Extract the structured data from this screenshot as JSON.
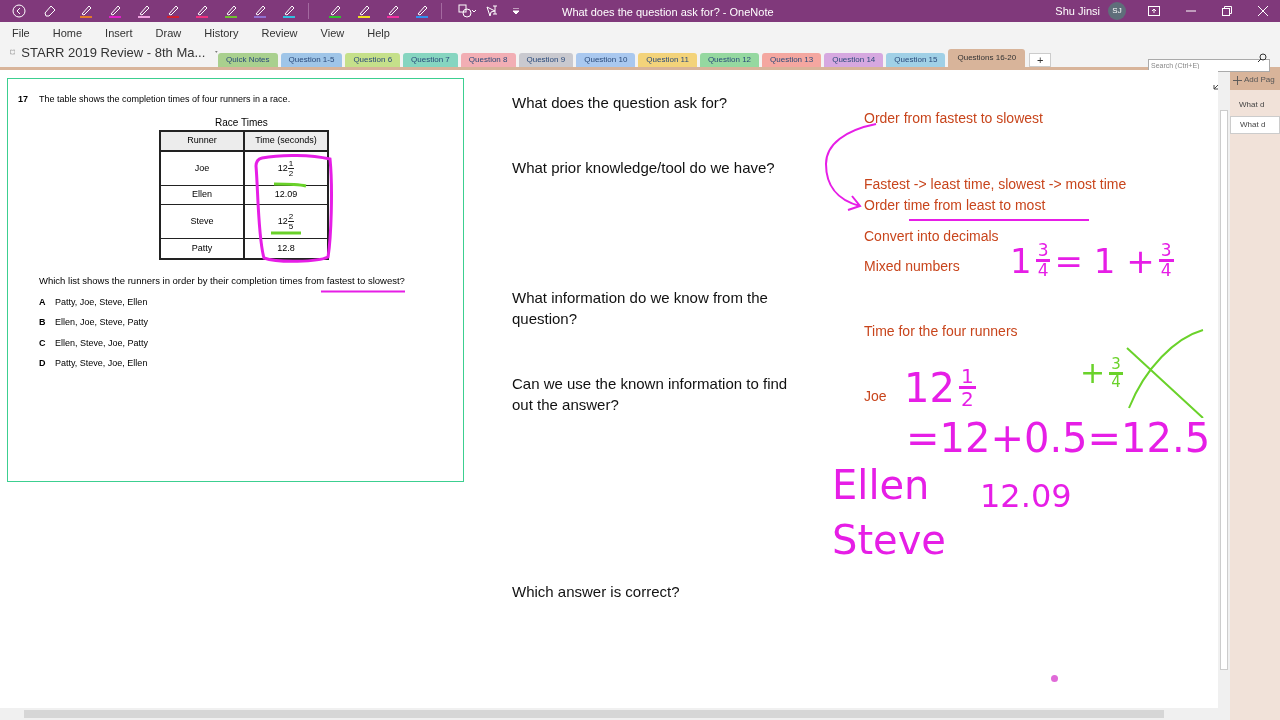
{
  "window": {
    "title": "What does the question ask for?  -  OneNote",
    "user": "Shu Jinsi",
    "initials": "SJ"
  },
  "pens": [
    {
      "color": "#e07a2a"
    },
    {
      "color": "#e020c8"
    },
    {
      "color": "#f0a0e0"
    },
    {
      "color": "#d02030"
    },
    {
      "color": "#f03080"
    },
    {
      "color": "#70c030"
    },
    {
      "color": "#9070d0"
    },
    {
      "color": "#30c0e0"
    }
  ],
  "highlighters": [
    {
      "color": "#30c030"
    },
    {
      "color": "#f0e020"
    },
    {
      "color": "#f030a0"
    },
    {
      "color": "#3090f0"
    }
  ],
  "menu": [
    "File",
    "Home",
    "Insert",
    "Draw",
    "History",
    "Review",
    "View",
    "Help"
  ],
  "notebook": "STARR 2019 Review - 8th Ma...",
  "sections": [
    {
      "label": "Quick Notes",
      "color": "#a9d08e",
      "selected": false
    },
    {
      "label": "Question 1-5",
      "color": "#9fc5e8",
      "selected": false
    },
    {
      "label": "Question 6",
      "color": "#c5e08a",
      "selected": false
    },
    {
      "label": "Question 7",
      "color": "#86d5c0",
      "selected": false
    },
    {
      "label": "Question 8",
      "color": "#f2aeb4",
      "selected": false
    },
    {
      "label": "Question 9",
      "color": "#c9c9cf",
      "selected": false
    },
    {
      "label": "Question 10",
      "color": "#a9c8ef",
      "selected": false
    },
    {
      "label": "Question 11",
      "color": "#f3d37a",
      "selected": false
    },
    {
      "label": "Question 12",
      "color": "#95d8a0",
      "selected": false
    },
    {
      "label": "Question 13",
      "color": "#f4a7a0",
      "selected": false
    },
    {
      "label": "Question 14",
      "color": "#d6a8e0",
      "selected": false
    },
    {
      "label": "Question 15",
      "color": "#a0d0e6",
      "selected": false
    },
    {
      "label": "Questions 16-20",
      "color": "#d8b49a",
      "selected": true
    }
  ],
  "add_section": "+",
  "search": {
    "placeholder": "Search (Ctrl+E)"
  },
  "pages_panel": {
    "add": "Add Pag",
    "pages": [
      {
        "title": "What d",
        "selected": false
      },
      {
        "title": "What d",
        "selected": true
      }
    ]
  },
  "question": {
    "number": "17",
    "stem": "The table shows the completion times of four runners in a race.",
    "table_title": "Race Times",
    "columns": [
      "Runner",
      "Time (seconds)"
    ],
    "rows": [
      {
        "runner": "Joe",
        "time": {
          "kind": "fraction",
          "whole": "12",
          "num": "1",
          "den": "2"
        }
      },
      {
        "runner": "Ellen",
        "time": {
          "kind": "decimal",
          "text": "12.09"
        }
      },
      {
        "runner": "Steve",
        "time": {
          "kind": "fraction",
          "whole": "12",
          "num": "2",
          "den": "5"
        }
      },
      {
        "runner": "Patty",
        "time": {
          "kind": "decimal",
          "text": "12.8"
        }
      }
    ],
    "prompt": "Which list shows the runners in order by their completion times from fastest to slowest?",
    "choices": [
      {
        "letter": "A",
        "text": "Patty, Joe, Steve, Ellen"
      },
      {
        "letter": "B",
        "text": "Ellen, Joe, Steve, Patty"
      },
      {
        "letter": "C",
        "text": "Ellen, Steve, Joe, Patty"
      },
      {
        "letter": "D",
        "text": "Patty, Steve, Joe, Ellen"
      }
    ]
  },
  "steps": [
    "What does the question ask for?",
    "What prior knowledge/tool do we have?",
    "What information do we know from the question?",
    "Can we use the known information to find out the answer?",
    "Which answer is correct?"
  ],
  "notes": [
    "Order from fastest to slowest",
    "Fastest -> least time, slowest -> most time",
    "Order time from least to most",
    "Convert into decimals",
    "Mixed numbers",
    "Time for the four runners",
    "Joe"
  ],
  "ink": [
    {
      "color": "#e61ee6",
      "struck": false,
      "parts": [
        {
          "t": "1"
        },
        {
          "num": "3",
          "den": "4"
        },
        {
          "t": "= 1 +"
        },
        {
          "num": "3",
          "den": "4"
        }
      ]
    },
    {
      "color": "#6ad22a",
      "struck": true,
      "parts": [
        {
          "t": "+"
        },
        {
          "num": "3",
          "den": "4"
        }
      ]
    },
    {
      "color": "#e61ee6",
      "struck": false,
      "parts": [
        {
          "t": "12"
        },
        {
          "num": "1",
          "den": "2"
        }
      ]
    },
    {
      "color": "#e61ee6",
      "struck": false,
      "parts": [
        {
          "t": "=12+0.5=12.5"
        }
      ]
    },
    {
      "color": "#e61ee6",
      "struck": false,
      "parts": [
        {
          "t": "Ellen"
        }
      ]
    },
    {
      "color": "#e61ee6",
      "struck": false,
      "parts": [
        {
          "t": "12.09"
        }
      ]
    },
    {
      "color": "#e61ee6",
      "struck": false,
      "parts": [
        {
          "t": "Steve"
        }
      ]
    }
  ]
}
